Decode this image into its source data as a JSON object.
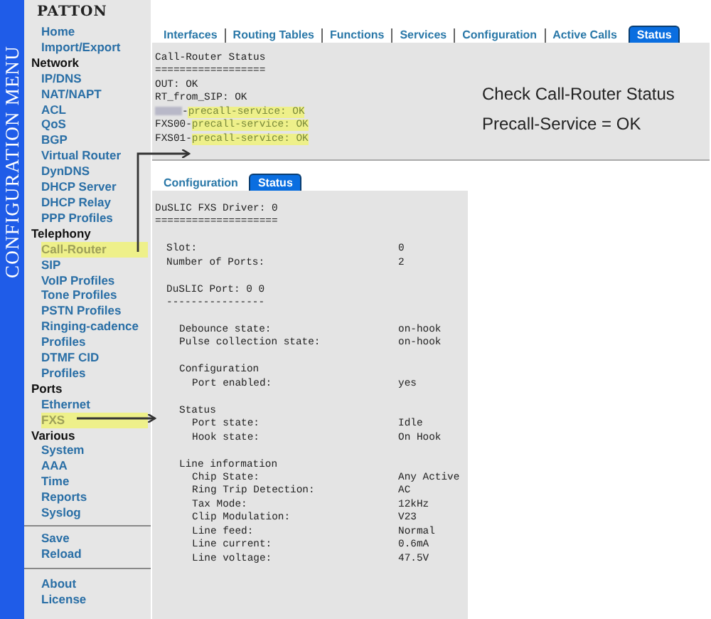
{
  "sidebar": {
    "label": "CONFIGURATION MENU",
    "logo": "PATTON",
    "sections": [
      {
        "items": [
          {
            "label": "Home",
            "highlighted": false
          },
          {
            "label": "Import/Export",
            "highlighted": false
          }
        ]
      },
      {
        "title": "Network",
        "items": [
          {
            "label": "IP/DNS",
            "highlighted": false
          },
          {
            "label": "NAT/NAPT",
            "highlighted": false
          },
          {
            "label": "ACL",
            "highlighted": false
          },
          {
            "label": "QoS",
            "highlighted": false
          },
          {
            "label": "BGP",
            "highlighted": false
          },
          {
            "label": "Virtual Router",
            "highlighted": false
          },
          {
            "label": "DynDNS",
            "highlighted": false
          },
          {
            "label": "DHCP Server",
            "highlighted": false
          },
          {
            "label": "DHCP Relay",
            "highlighted": false
          },
          {
            "label": "PPP Profiles",
            "highlighted": false
          }
        ]
      },
      {
        "title": "Telephony",
        "items": [
          {
            "label": "Call-Router",
            "highlighted": true
          },
          {
            "label": "SIP",
            "highlighted": false
          },
          {
            "label": "VoIP Profiles",
            "highlighted": false
          },
          {
            "label": "Tone Profiles",
            "highlighted": false
          },
          {
            "label": "PSTN Profiles",
            "highlighted": false
          },
          {
            "label": "Ringing-cadence Profiles",
            "highlighted": false
          },
          {
            "label": "DTMF CID Profiles",
            "highlighted": false
          }
        ]
      },
      {
        "title": "Ports",
        "items": [
          {
            "label": "Ethernet",
            "highlighted": false
          },
          {
            "label": "FXS",
            "highlighted": true
          }
        ]
      },
      {
        "title": "Various",
        "items": [
          {
            "label": "System",
            "highlighted": false
          },
          {
            "label": "AAA",
            "highlighted": false
          },
          {
            "label": "Time",
            "highlighted": false
          },
          {
            "label": "Reports",
            "highlighted": false
          },
          {
            "label": "Syslog",
            "highlighted": false
          }
        ]
      },
      {
        "items": [
          {
            "label": "Save",
            "highlighted": false
          },
          {
            "label": "Reload",
            "highlighted": false
          }
        ]
      },
      {
        "items": [
          {
            "label": "About",
            "highlighted": false
          },
          {
            "label": "License",
            "highlighted": false
          }
        ]
      }
    ]
  },
  "router_panel": {
    "tabs": [
      {
        "label": "Interfaces",
        "selected": false
      },
      {
        "label": "Routing Tables",
        "selected": false
      },
      {
        "label": "Functions",
        "selected": false
      },
      {
        "label": "Services",
        "selected": false
      },
      {
        "label": "Configuration",
        "selected": false
      },
      {
        "label": "Active Calls",
        "selected": false
      },
      {
        "label": "Status",
        "selected": true
      }
    ],
    "lines": [
      {
        "text": "Call-Router Status",
        "redacted": false
      },
      {
        "text": "==================",
        "redacted": false
      },
      {
        "text": "OUT: OK",
        "redacted": false
      },
      {
        "text": "RT_from_SIP: OK",
        "redacted": false
      },
      {
        "text": "-",
        "highlight": "precall-service: OK",
        "redacted": true
      },
      {
        "text": "FXS00-",
        "highlight": "precall-service: OK",
        "redacted": false
      },
      {
        "text": "FXS01-",
        "highlight": "precall-service: OK",
        "redacted": false
      }
    ],
    "notes": [
      "Check Call-Router Status",
      "Precall-Service = OK"
    ]
  },
  "fxs_panel": {
    "tabs": [
      {
        "label": "Configuration",
        "selected": false
      },
      {
        "label": "Status",
        "selected": true
      }
    ],
    "title": "DuSLIC FXS Driver: 0",
    "rule": "====================",
    "fields": [
      {
        "label": "Slot:",
        "value": "0"
      },
      {
        "label": "Number of Ports:",
        "value": "2"
      }
    ],
    "port": {
      "title": "DuSLIC Port: 0 0",
      "rule": "----------------",
      "fields": [
        {
          "label": "Debounce state:",
          "value": "on-hook"
        },
        {
          "label": "Pulse collection state:",
          "value": "on-hook"
        }
      ],
      "groups": [
        {
          "title": "Configuration",
          "fields": [
            {
              "label": "Port enabled:",
              "value": "yes"
            }
          ]
        },
        {
          "title": "Status",
          "fields": [
            {
              "label": "Port state:",
              "value": "Idle"
            },
            {
              "label": "Hook state:",
              "value": "On Hook"
            }
          ]
        },
        {
          "title": "Line information",
          "fields": [
            {
              "label": "Chip State:",
              "value": "Any Active"
            },
            {
              "label": "Ring Trip Detection:",
              "value": "AC"
            },
            {
              "label": "Tax Mode:",
              "value": "12kHz"
            },
            {
              "label": "Clip Modulation:",
              "value": "V23"
            },
            {
              "label": "Line feed:",
              "value": "Normal"
            },
            {
              "label": "Line current:",
              "value": "0.6mA"
            },
            {
              "label": "Line voltage:",
              "value": "47.5V"
            }
          ]
        }
      ]
    }
  }
}
